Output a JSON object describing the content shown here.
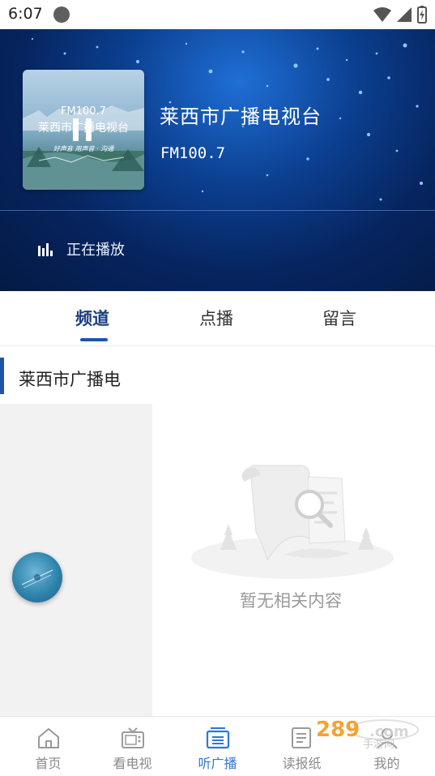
{
  "status_bar": {
    "time": "6:07"
  },
  "player": {
    "cover_freq": "FM100.7",
    "cover_name": "莱西市广播电视台",
    "cover_slogan": "好声音 用声音 · 沟通",
    "station_name": "莱西市广播电视台",
    "frequency": "FM100.7",
    "status_label": "正在播放"
  },
  "tabs": [
    {
      "label": "频道"
    },
    {
      "label": "点播"
    },
    {
      "label": "留言"
    }
  ],
  "section": {
    "title": "莱西市广播电"
  },
  "empty_state": {
    "message": "暂无相关内容"
  },
  "bottom_nav": [
    {
      "label": "首页"
    },
    {
      "label": "看电视"
    },
    {
      "label": "听广播"
    },
    {
      "label": "读报纸"
    },
    {
      "label": "我的"
    }
  ],
  "watermark": {
    "text": "289手游网"
  },
  "colors": {
    "accent": "#1f55a6",
    "nav_active": "#2d77d6",
    "hero_dark": "#06245e"
  }
}
